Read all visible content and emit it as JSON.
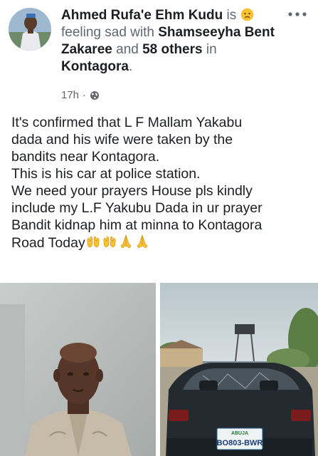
{
  "post": {
    "author": "Ahmed Rufa'e Ehm Kudu",
    "is_word": "is",
    "feeling_text": "feeling sad with",
    "tagged_user": "Shamseeyha Bent Zakaree",
    "and_word": "and",
    "others": "58 others",
    "in_word": "in",
    "location": "Kontagora",
    "period": ".",
    "timestamp": "17h",
    "separator": "·",
    "feeling_icon": "sad-face-icon",
    "audience_icon": "globe-icon",
    "menu_icon": "more-dots-icon"
  },
  "body": {
    "lines": [
      "It's confirmed that L F Mallam Yakabu",
      "dada and his wife were taken by the",
      "bandits near Kontagora.",
      "This is his car at police station.",
      "We need your prayers House pls kindly",
      "include my L.F Yakubu Dada in ur prayer",
      "Bandit kidnap him at minna to Kontagora",
      "Road Today"
    ],
    "emojis": [
      "open-hands-icon",
      "open-hands-icon",
      "praying-hands-icon",
      "praying-hands-icon"
    ]
  },
  "photos": {
    "left_alt_subject": "man-portrait",
    "right_alt_subject": "car-at-police-station",
    "plate_text": "BO803-BWR",
    "plate_state": "ABUJA"
  },
  "colors": {
    "text": "#1c1e21",
    "meta": "#65676b",
    "emoji_yellow": "#f7c12f"
  }
}
